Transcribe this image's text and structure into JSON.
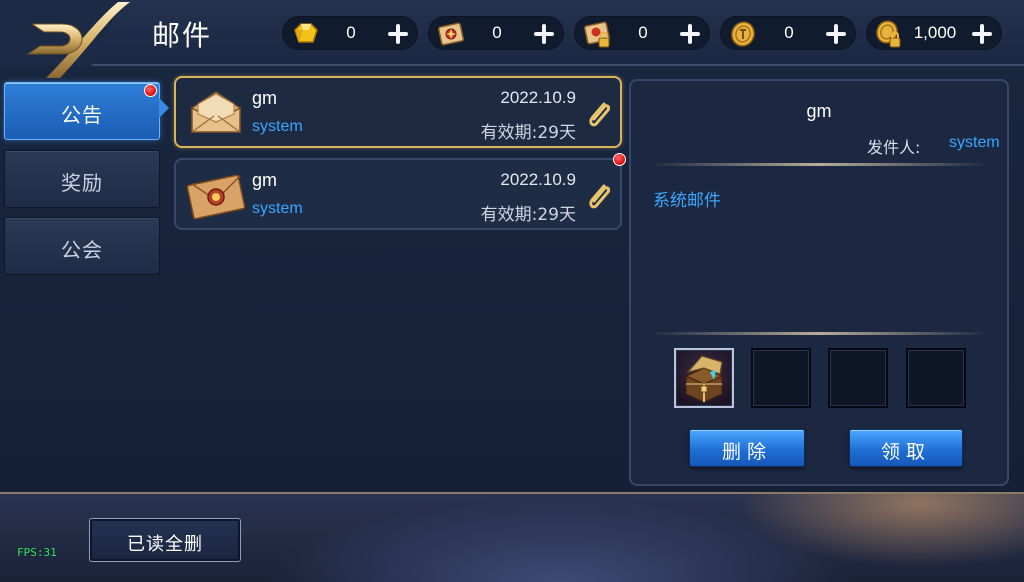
{
  "header": {
    "title": "邮件",
    "currencies": [
      {
        "icon": "gem-icon",
        "value": "0"
      },
      {
        "icon": "scroll-icon",
        "value": "0"
      },
      {
        "icon": "locked-scroll-icon",
        "value": "0"
      },
      {
        "icon": "coin-icon",
        "value": "0"
      },
      {
        "icon": "locked-coin-icon",
        "value": "1,000"
      }
    ]
  },
  "tabs": [
    {
      "label": "公告",
      "active": true,
      "has_notification": true
    },
    {
      "label": "奖励",
      "active": false,
      "has_notification": false
    },
    {
      "label": "公会",
      "active": false,
      "has_notification": false
    }
  ],
  "mails": [
    {
      "sender": "gm",
      "type": "system",
      "date": "2022.10.9",
      "expire": "有效期:29天",
      "icon": "opened-envelope-icon",
      "selected": true,
      "unread": false,
      "has_attachment": true
    },
    {
      "sender": "gm",
      "type": "system",
      "date": "2022.10.9",
      "expire": "有效期:29天",
      "icon": "sealed-envelope-icon",
      "selected": false,
      "unread": true,
      "has_attachment": true
    }
  ],
  "detail": {
    "sender": "gm",
    "from_label": "发件人:",
    "from_value": "system",
    "body": "系统邮件",
    "attachments": [
      {
        "icon": "treasure-chest-icon",
        "filled": true
      },
      {
        "filled": false
      },
      {
        "filled": false
      },
      {
        "filled": false
      }
    ],
    "delete_label": "删除",
    "claim_label": "领取"
  },
  "footer": {
    "delete_read_label": "已读全删",
    "fps": "FPS:31"
  },
  "colors": {
    "accent_blue": "#3aa6ff",
    "selected_gold": "#d9b45a",
    "notification_red": "#e01616",
    "fps_green": "#2ee05a"
  }
}
